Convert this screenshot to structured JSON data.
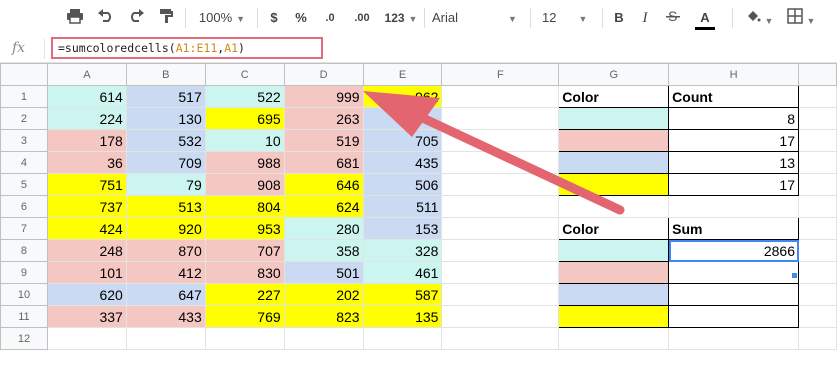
{
  "toolbar": {
    "zoom": "100%",
    "currency": "$",
    "percent": "%",
    "dec_dec": ".0",
    "dec_inc": ".00",
    "more_formats": "123",
    "font": "Arial",
    "font_size": "12",
    "bold": "B",
    "italic": "I",
    "text_color": "A"
  },
  "formula_bar": {
    "fx": "fx",
    "formula_prefix": "=sumcoloredcells(",
    "formula_range": "A1:E11",
    "formula_sep": ",",
    "formula_arg": "A1",
    "formula_suffix": ")"
  },
  "columns": [
    "A",
    "B",
    "C",
    "D",
    "E",
    "F",
    "G",
    "H"
  ],
  "rows": [
    "1",
    "2",
    "3",
    "4",
    "5",
    "6",
    "7",
    "8",
    "9",
    "10",
    "11",
    "12"
  ],
  "colors": {
    "cyan": "#ccf5f0",
    "pink": "#f4c7c3",
    "blue": "#c9daf2",
    "yellow": "#ffff00",
    "accent": "#4285f4",
    "arrow": "#e2656f"
  },
  "grid": {
    "cells": [
      [
        {
          "v": "614",
          "c": "cyan"
        },
        {
          "v": "517",
          "c": "blue"
        },
        {
          "v": "522",
          "c": "cyan"
        },
        {
          "v": "999",
          "c": "pink"
        },
        {
          "v": "962",
          "c": "yellow"
        }
      ],
      [
        {
          "v": "224",
          "c": "cyan"
        },
        {
          "v": "130",
          "c": "blue"
        },
        {
          "v": "695",
          "c": "yellow"
        },
        {
          "v": "263",
          "c": "pink"
        },
        {
          "v": "",
          "c": "blue"
        }
      ],
      [
        {
          "v": "178",
          "c": "pink"
        },
        {
          "v": "532",
          "c": "blue"
        },
        {
          "v": "10",
          "c": "cyan"
        },
        {
          "v": "519",
          "c": "pink"
        },
        {
          "v": "705",
          "c": "blue"
        }
      ],
      [
        {
          "v": "36",
          "c": "pink"
        },
        {
          "v": "709",
          "c": "blue"
        },
        {
          "v": "988",
          "c": "pink"
        },
        {
          "v": "681",
          "c": "pink"
        },
        {
          "v": "435",
          "c": "blue"
        }
      ],
      [
        {
          "v": "751",
          "c": "yellow"
        },
        {
          "v": "79",
          "c": "cyan"
        },
        {
          "v": "908",
          "c": "pink"
        },
        {
          "v": "646",
          "c": "yellow"
        },
        {
          "v": "506",
          "c": "blue"
        }
      ],
      [
        {
          "v": "737",
          "c": "yellow"
        },
        {
          "v": "513",
          "c": "yellow"
        },
        {
          "v": "804",
          "c": "yellow"
        },
        {
          "v": "624",
          "c": "yellow"
        },
        {
          "v": "511",
          "c": "blue"
        }
      ],
      [
        {
          "v": "424",
          "c": "yellow"
        },
        {
          "v": "920",
          "c": "yellow"
        },
        {
          "v": "953",
          "c": "yellow"
        },
        {
          "v": "280",
          "c": "cyan"
        },
        {
          "v": "153",
          "c": "blue"
        }
      ],
      [
        {
          "v": "248",
          "c": "pink"
        },
        {
          "v": "870",
          "c": "pink"
        },
        {
          "v": "707",
          "c": "pink"
        },
        {
          "v": "358",
          "c": "cyan"
        },
        {
          "v": "328",
          "c": "cyan"
        }
      ],
      [
        {
          "v": "101",
          "c": "pink"
        },
        {
          "v": "412",
          "c": "pink"
        },
        {
          "v": "830",
          "c": "pink"
        },
        {
          "v": "501",
          "c": "blue"
        },
        {
          "v": "461",
          "c": "cyan"
        }
      ],
      [
        {
          "v": "620",
          "c": "blue"
        },
        {
          "v": "647",
          "c": "blue"
        },
        {
          "v": "227",
          "c": "yellow"
        },
        {
          "v": "202",
          "c": "yellow"
        },
        {
          "v": "587",
          "c": "yellow"
        }
      ],
      [
        {
          "v": "337",
          "c": "pink"
        },
        {
          "v": "433",
          "c": "pink"
        },
        {
          "v": "769",
          "c": "yellow"
        },
        {
          "v": "823",
          "c": "yellow"
        },
        {
          "v": "135",
          "c": "yellow"
        }
      ]
    ]
  },
  "count_table": {
    "header_color": "Color",
    "header_count": "Count",
    "rows": [
      {
        "c": "cyan",
        "v": "8"
      },
      {
        "c": "pink",
        "v": "17"
      },
      {
        "c": "blue",
        "v": "13"
      },
      {
        "c": "yellow",
        "v": "17"
      }
    ]
  },
  "sum_table": {
    "header_color": "Color",
    "header_sum": "Sum",
    "rows": [
      {
        "c": "cyan",
        "v": "2866"
      },
      {
        "c": "pink",
        "v": ""
      },
      {
        "c": "blue",
        "v": ""
      },
      {
        "c": "yellow",
        "v": ""
      }
    ]
  }
}
